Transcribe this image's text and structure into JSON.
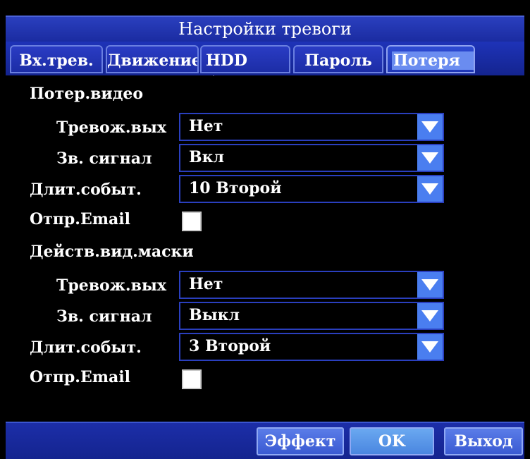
{
  "window": {
    "title": "Настройки тревоги"
  },
  "tabs": [
    {
      "label": "Вх.трев.",
      "active": false
    },
    {
      "label": "Движение",
      "active": false
    },
    {
      "label": "HDD",
      "active": false
    },
    {
      "label": "Пароль",
      "active": false
    },
    {
      "label": "Потеря",
      "active": true
    }
  ],
  "video_loss": {
    "heading": "Потер.видео",
    "alarm_out_label": "Тревож.вых",
    "alarm_out_value": "Нет",
    "buzzer_label": "Зв. сигнал",
    "buzzer_value": "Вкл",
    "duration_label": "Длит.событ.",
    "duration_value": "10 Второй",
    "email_label": "Отпр.Email",
    "email_checked": false
  },
  "video_mask": {
    "heading": "Действ.вид.маски",
    "alarm_out_label": "Тревож.вых",
    "alarm_out_value": "Нет",
    "buzzer_label": "Зв. сигнал",
    "buzzer_value": "Выкл",
    "duration_label": "Длит.событ.",
    "duration_value": "3 Второй",
    "email_label": "Отпр.Email",
    "email_checked": false
  },
  "footer": {
    "effect_label": "Эффект",
    "ok_label": "OK",
    "exit_label": "Выход"
  },
  "colors": {
    "title_bar": "#2a3fbe",
    "dropdown_arrow": "#4a7ef0",
    "active_tab_highlight": "#6a8cf0"
  },
  "icons": {
    "dropdown": "chevron-down-icon",
    "pointer": "mouse-cursor-icon"
  }
}
